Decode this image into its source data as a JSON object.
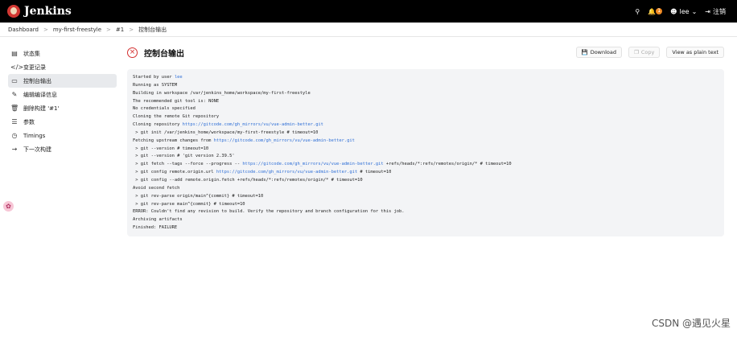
{
  "app": {
    "name": "Jenkins"
  },
  "header": {
    "user": "lee",
    "logout": "注销",
    "notification_count": "1"
  },
  "breadcrumb": [
    "Dashboard",
    "my-first-freestyle",
    "#1",
    "控制台输出"
  ],
  "sidebar": {
    "items": [
      {
        "icon": "document-icon",
        "label": "状态集"
      },
      {
        "icon": "code-icon",
        "label": "变更记录"
      },
      {
        "icon": "console-icon",
        "label": "控制台输出"
      },
      {
        "icon": "edit-icon",
        "label": "编辑编译信息"
      },
      {
        "icon": "trash-icon",
        "label": "删除构建 '#1'"
      },
      {
        "icon": "parameters-icon",
        "label": "参数"
      },
      {
        "icon": "clock-icon",
        "label": "Timings"
      },
      {
        "icon": "arrow-right-icon",
        "label": "下一次构建"
      }
    ]
  },
  "main": {
    "title": "控制台输出",
    "actions": {
      "download": "Download",
      "copy": "Copy",
      "plain": "View as plain text"
    }
  },
  "console": {
    "lines": [
      {
        "text": "Started by user ",
        "link": "lee"
      },
      {
        "text": "Running as SYSTEM"
      },
      {
        "text": "Building in workspace /var/jenkins_home/workspace/my-first-freestyle"
      },
      {
        "text": "The recommended git tool is: NONE"
      },
      {
        "text": "No credentials specified"
      },
      {
        "text": "Cloning the remote Git repository"
      },
      {
        "text": "Cloning repository ",
        "link": "https://gitcode.com/gh_mirrors/vu/vue-admin-better.git"
      },
      {
        "text": " > git init /var/jenkins_home/workspace/my-first-freestyle # timeout=10"
      },
      {
        "text": "Fetching upstream changes from ",
        "link": "https://gitcode.com/gh_mirrors/vu/vue-admin-better.git"
      },
      {
        "text": " > git --version # timeout=10"
      },
      {
        "text": " > git --version # 'git version 2.39.5'"
      },
      {
        "text": " > git fetch --tags --force --progress -- ",
        "link": "https://gitcode.com/gh_mirrors/vu/vue-admin-better.git",
        "after": " +refs/heads/*:refs/remotes/origin/* # timeout=10"
      },
      {
        "text": " > git config remote.origin.url ",
        "link": "https://gitcode.com/gh_mirrors/vu/vue-admin-better.git",
        "after": " # timeout=10"
      },
      {
        "text": " > git config --add remote.origin.fetch +refs/heads/*:refs/remotes/origin/* # timeout=10"
      },
      {
        "text": "Avoid second fetch"
      },
      {
        "text": " > git rev-parse origin/main^{commit} # timeout=10"
      },
      {
        "text": " > git rev-parse main^{commit} # timeout=10"
      },
      {
        "text": "ERROR: Couldn't find any revision to build. Verify the repository and branch configuration for this job."
      },
      {
        "text": "Archiving artifacts"
      },
      {
        "text": "Finished: FAILURE"
      }
    ]
  },
  "watermark": "CSDN @遇见火星",
  "colors": {
    "topbar": "#000000",
    "link": "#2f6fd6",
    "failure": "#d32f2f",
    "console_bg": "#f3f4f6"
  }
}
